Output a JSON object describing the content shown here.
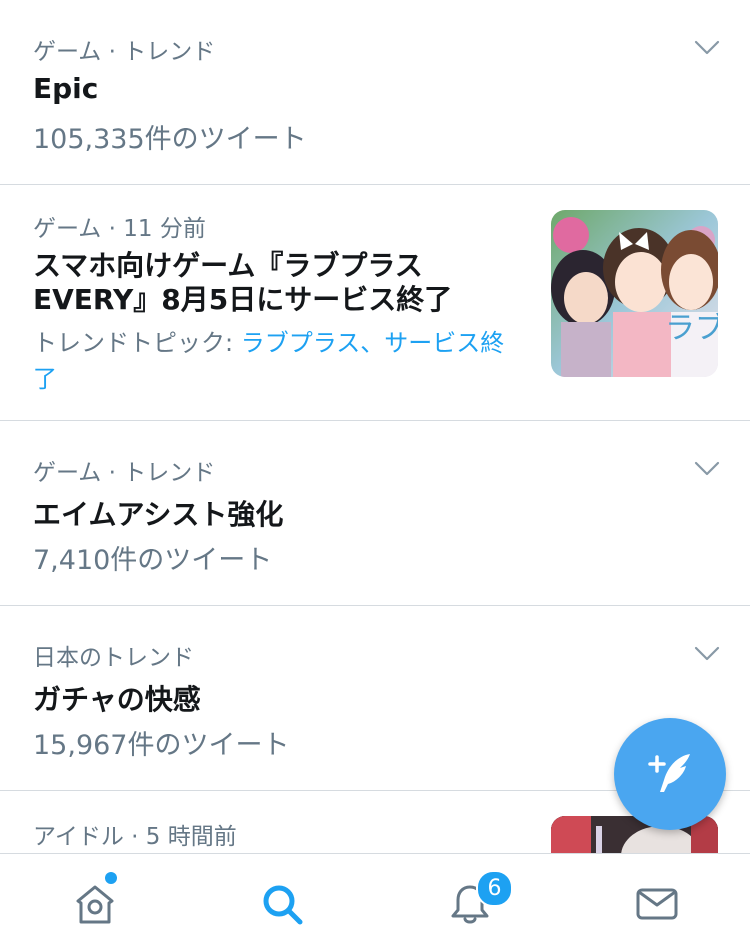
{
  "trends": [
    {
      "meta": "ゲーム · トレンド",
      "title": "Epic",
      "count": "105,335件のツイート"
    },
    {
      "meta": "ゲーム · 11 分前",
      "title": "スマホ向けゲーム『ラブプラス EVERY』8月5日にサービス終了",
      "topics_prefix": "トレンドトピック: ",
      "topics_links": "ラブプラス、サービス終了"
    },
    {
      "meta": "ゲーム · トレンド",
      "title": "エイムアシスト強化",
      "count": "7,410件のツイート"
    },
    {
      "meta": "日本のトレンド",
      "title": "ガチャの快感",
      "count": "15,967件のツイート"
    },
    {
      "meta": "アイドル · 5 時間前"
    }
  ],
  "tabbar": {
    "notifications_badge": "6"
  },
  "colors": {
    "accent": "#1da1f2",
    "fab": "#4aa6f0",
    "secondary_text": "#657786",
    "divider": "#d6dbe0"
  },
  "icons": {
    "chevron": "chevron-down-icon",
    "compose": "compose-tweet-icon",
    "home": "home-icon",
    "search": "search-icon",
    "notifications": "bell-icon",
    "messages": "envelope-icon"
  }
}
